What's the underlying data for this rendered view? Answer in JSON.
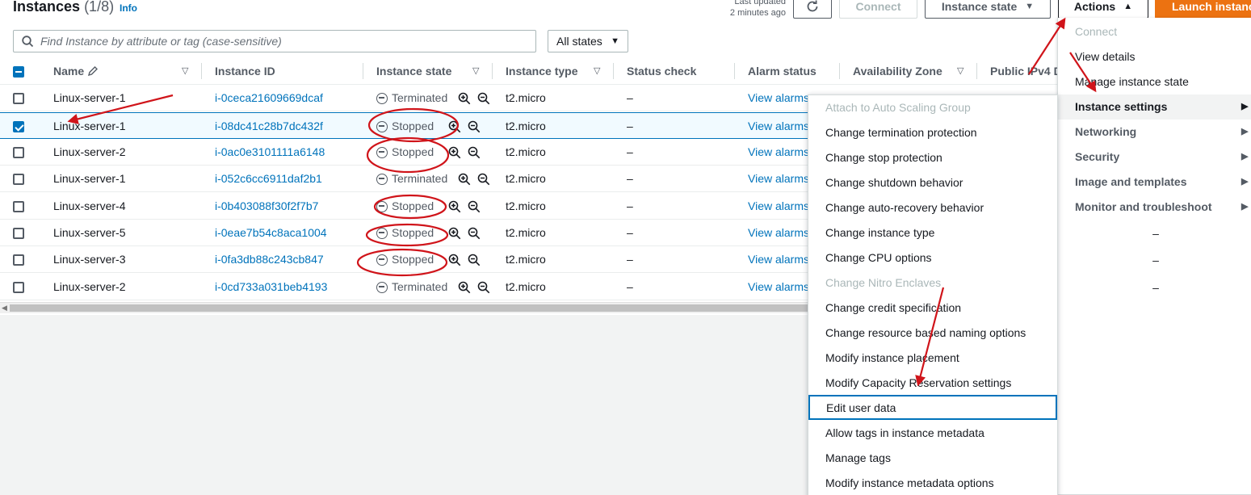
{
  "header": {
    "title": "Instances",
    "count": "(1/8)",
    "info": "Info",
    "last_updated_1": "Last updated",
    "last_updated_2": "2 minutes ago",
    "connect": "Connect",
    "instance_state": "Instance state",
    "actions": "Actions",
    "launch": "Launch instance"
  },
  "search": {
    "placeholder": "Find Instance by attribute or tag (case-sensitive)"
  },
  "filter": {
    "value": "All states"
  },
  "columns": [
    "Name",
    "Instance ID",
    "Instance state",
    "Instance type",
    "Status check",
    "Alarm status",
    "Availability Zone",
    "Public IPv4 D"
  ],
  "rows": [
    {
      "name": "Linux-server-1",
      "id": "i-0ceca21609669dcaf",
      "state": "Terminated",
      "type": "t2.micro",
      "status": "–",
      "alarm": "View alarms"
    },
    {
      "name": "Linux-server-1",
      "id": "i-08dc41c28b7dc432f",
      "state": "Stopped",
      "type": "t2.micro",
      "status": "–",
      "alarm": "View alarms"
    },
    {
      "name": "Linux-server-2",
      "id": "i-0ac0e3101111a6148",
      "state": "Stopped",
      "type": "t2.micro",
      "status": "–",
      "alarm": "View alarms"
    },
    {
      "name": "Linux-server-1",
      "id": "i-052c6cc6911daf2b1",
      "state": "Terminated",
      "type": "t2.micro",
      "status": "–",
      "alarm": "View alarms"
    },
    {
      "name": "Linux-server-4",
      "id": "i-0b403088f30f2f7b7",
      "state": "Stopped",
      "type": "t2.micro",
      "status": "–",
      "alarm": "View alarms"
    },
    {
      "name": "Linux-server-5",
      "id": "i-0eae7b54c8aca1004",
      "state": "Stopped",
      "type": "t2.micro",
      "status": "–",
      "alarm": "View alarms"
    },
    {
      "name": "Linux-server-3",
      "id": "i-0fa3db88c243cb847",
      "state": "Stopped",
      "type": "t2.micro",
      "status": "–",
      "alarm": "View alarms"
    },
    {
      "name": "Linux-server-2",
      "id": "i-0cd733a031beb4193",
      "state": "Terminated",
      "type": "t2.micro",
      "status": "–",
      "alarm": "View alarms"
    }
  ],
  "actions_menu": [
    {
      "label": "Connect"
    },
    {
      "label": "View details"
    },
    {
      "label": "Manage instance state"
    },
    {
      "label": "Instance settings"
    },
    {
      "label": "Networking"
    },
    {
      "label": "Security"
    },
    {
      "label": "Image and templates"
    },
    {
      "label": "Monitor and troubleshoot"
    }
  ],
  "menu_dash": "–",
  "instance_settings_menu": [
    {
      "label": "Attach to Auto Scaling Group"
    },
    {
      "label": "Change termination protection"
    },
    {
      "label": "Change stop protection"
    },
    {
      "label": "Change shutdown behavior"
    },
    {
      "label": "Change auto-recovery behavior"
    },
    {
      "label": "Change instance type"
    },
    {
      "label": "Change CPU options"
    },
    {
      "label": "Change Nitro Enclaves"
    },
    {
      "label": "Change credit specification"
    },
    {
      "label": "Change resource based naming options"
    },
    {
      "label": "Modify instance placement"
    },
    {
      "label": "Modify Capacity Reservation settings"
    },
    {
      "label": "Edit user data"
    },
    {
      "label": "Allow tags in instance metadata"
    },
    {
      "label": "Manage tags"
    },
    {
      "label": "Modify instance metadata options"
    }
  ],
  "colors": {
    "link": "#0073bb",
    "primary": "#ec7211",
    "annotation": "#d0141a"
  }
}
